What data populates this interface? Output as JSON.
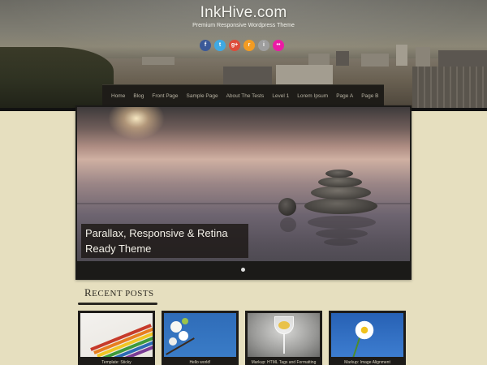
{
  "site": {
    "title": "InkHive.com",
    "tagline": "Premium Responsive Wordpress Theme"
  },
  "social": [
    {
      "icon": "facebook-icon",
      "glyph": "f",
      "color": "#3b5998"
    },
    {
      "icon": "twitter-icon",
      "glyph": "t",
      "color": "#3fa9e3"
    },
    {
      "icon": "google-plus-icon",
      "glyph": "g+",
      "color": "#dd4b39"
    },
    {
      "icon": "rss-icon",
      "glyph": "r",
      "color": "#f39c22"
    },
    {
      "icon": "instagram-icon",
      "glyph": "i",
      "color": "#9e9e9e"
    },
    {
      "icon": "flickr-icon",
      "glyph": "••",
      "color": "#ec1aa5"
    }
  ],
  "nav": {
    "items": [
      "Home",
      "Blog",
      "Front Page",
      "Sample Page",
      "About The Tests",
      "Level 1",
      "Lorem Ipsum",
      "Page A",
      "Page B"
    ]
  },
  "slider": {
    "caption": "Parallax, Responsive & Retina Ready Theme"
  },
  "recent": {
    "heading_first": "R",
    "heading_rest": "ECENT POSTS",
    "posts": [
      {
        "title": "Template: Sticky"
      },
      {
        "title": "Hello world!"
      },
      {
        "title": "Markup: HTML Tags and Formatting"
      },
      {
        "title": "Markup: Image Alignment"
      }
    ]
  }
}
